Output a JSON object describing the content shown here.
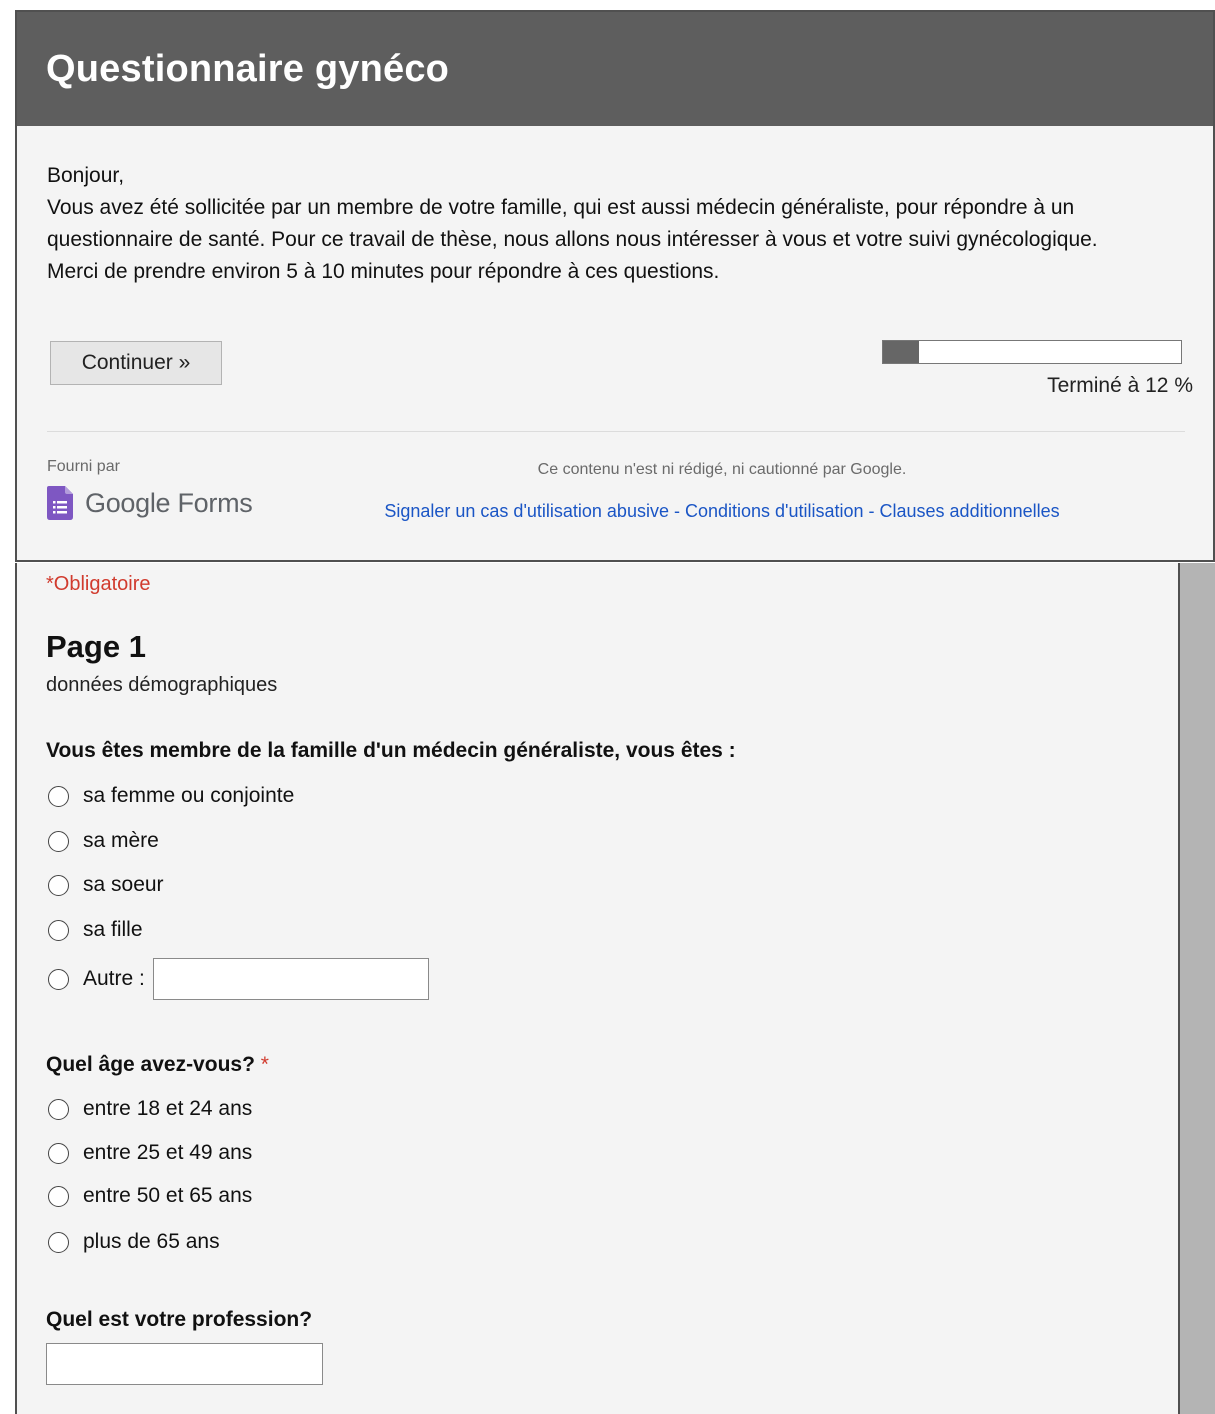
{
  "form": {
    "title": "Questionnaire gynéco",
    "intro": [
      "Bonjour,",
      "Vous avez été sollicitée par un membre de votre famille, qui est aussi médecin généraliste, pour répondre à un questionnaire de santé. Pour ce travail de thèse, nous allons nous intéresser à vous et votre suivi gynécologique.",
      "Merci de prendre environ 5 à 10 minutes pour répondre à ces questions."
    ],
    "continue_label": "Continuer »",
    "progress": {
      "percent": 12,
      "label": "Terminé à 12 %"
    }
  },
  "footer": {
    "provided_by": "Fourni par",
    "brand": "Google Forms",
    "brand_icon": "google-forms-icon",
    "brand_color": "#7e57c2",
    "disclaimer": "Ce contenu n'est ni rédigé, ni cautionné par Google.",
    "links": [
      "Signaler un cas d'utilisation abusive",
      "Conditions d'utilisation",
      "Clauses additionnelles"
    ],
    "link_separator": " - "
  },
  "page": {
    "required_note": "*Obligatoire",
    "title": "Page 1",
    "description": "données démographiques"
  },
  "questions": [
    {
      "title": "Vous êtes membre de la famille d'un médecin généraliste, vous êtes :",
      "required": false,
      "options": [
        "sa femme ou conjointe",
        "sa mère",
        "sa soeur",
        "sa fille"
      ],
      "other_label": "Autre :",
      "other_value": ""
    },
    {
      "title": "Quel âge avez-vous?",
      "required": true,
      "required_mark": "*",
      "options": [
        "entre 18 et 24 ans",
        "entre 25 et 49 ans",
        "entre 50 et 65 ans",
        "plus de 65 ans"
      ]
    },
    {
      "title": "Quel est votre profession?",
      "required": false,
      "value": ""
    }
  ],
  "colors": {
    "header_bg": "#5e5e5e",
    "required": "#d13b2e",
    "link": "#1a55c5",
    "progress_fill": "#666666"
  }
}
